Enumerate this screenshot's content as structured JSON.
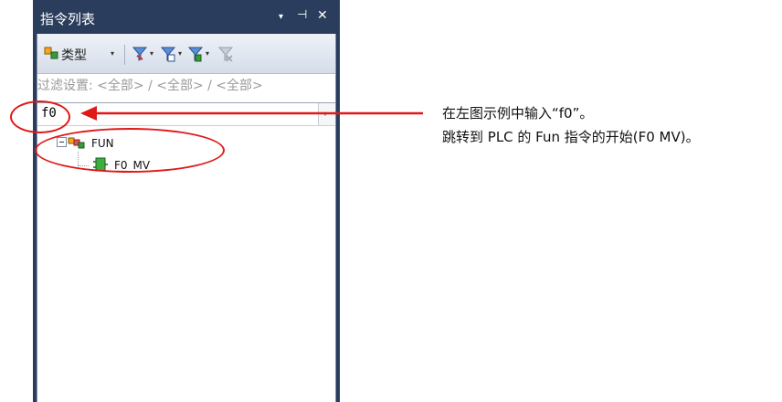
{
  "panel": {
    "title": "指令列表",
    "controls": {
      "dropdown": "▾",
      "pin": "⊣",
      "close": "✕"
    }
  },
  "toolbar": {
    "type_label": "类型",
    "type_dropdown": "▾",
    "filter_dropdown": "▾"
  },
  "filter": {
    "text": "过滤设置: <全部> / <全部> / <全部>"
  },
  "search": {
    "value": "f0",
    "dropdown": "▾"
  },
  "tree": {
    "folder_label": "FUN",
    "item_label": "F0_MV"
  },
  "annotation": {
    "line1": "在左图示例中输入“f0”。",
    "line2": "跳转到 PLC 的 Fun 指令的开始(F0 MV)。"
  },
  "colors": {
    "title_bar": "#2b3d5c",
    "highlight_red": "#e01818",
    "filter_text": "#9a9a9a"
  },
  "icons": {
    "type": "type-filter-icon",
    "filter1": "filter-icon",
    "filter2": "filter-add-icon",
    "filter3": "filter-function-icon",
    "filter4": "filter-clear-icon",
    "folder": "folder-group-icon",
    "instruction": "instruction-block-icon"
  }
}
